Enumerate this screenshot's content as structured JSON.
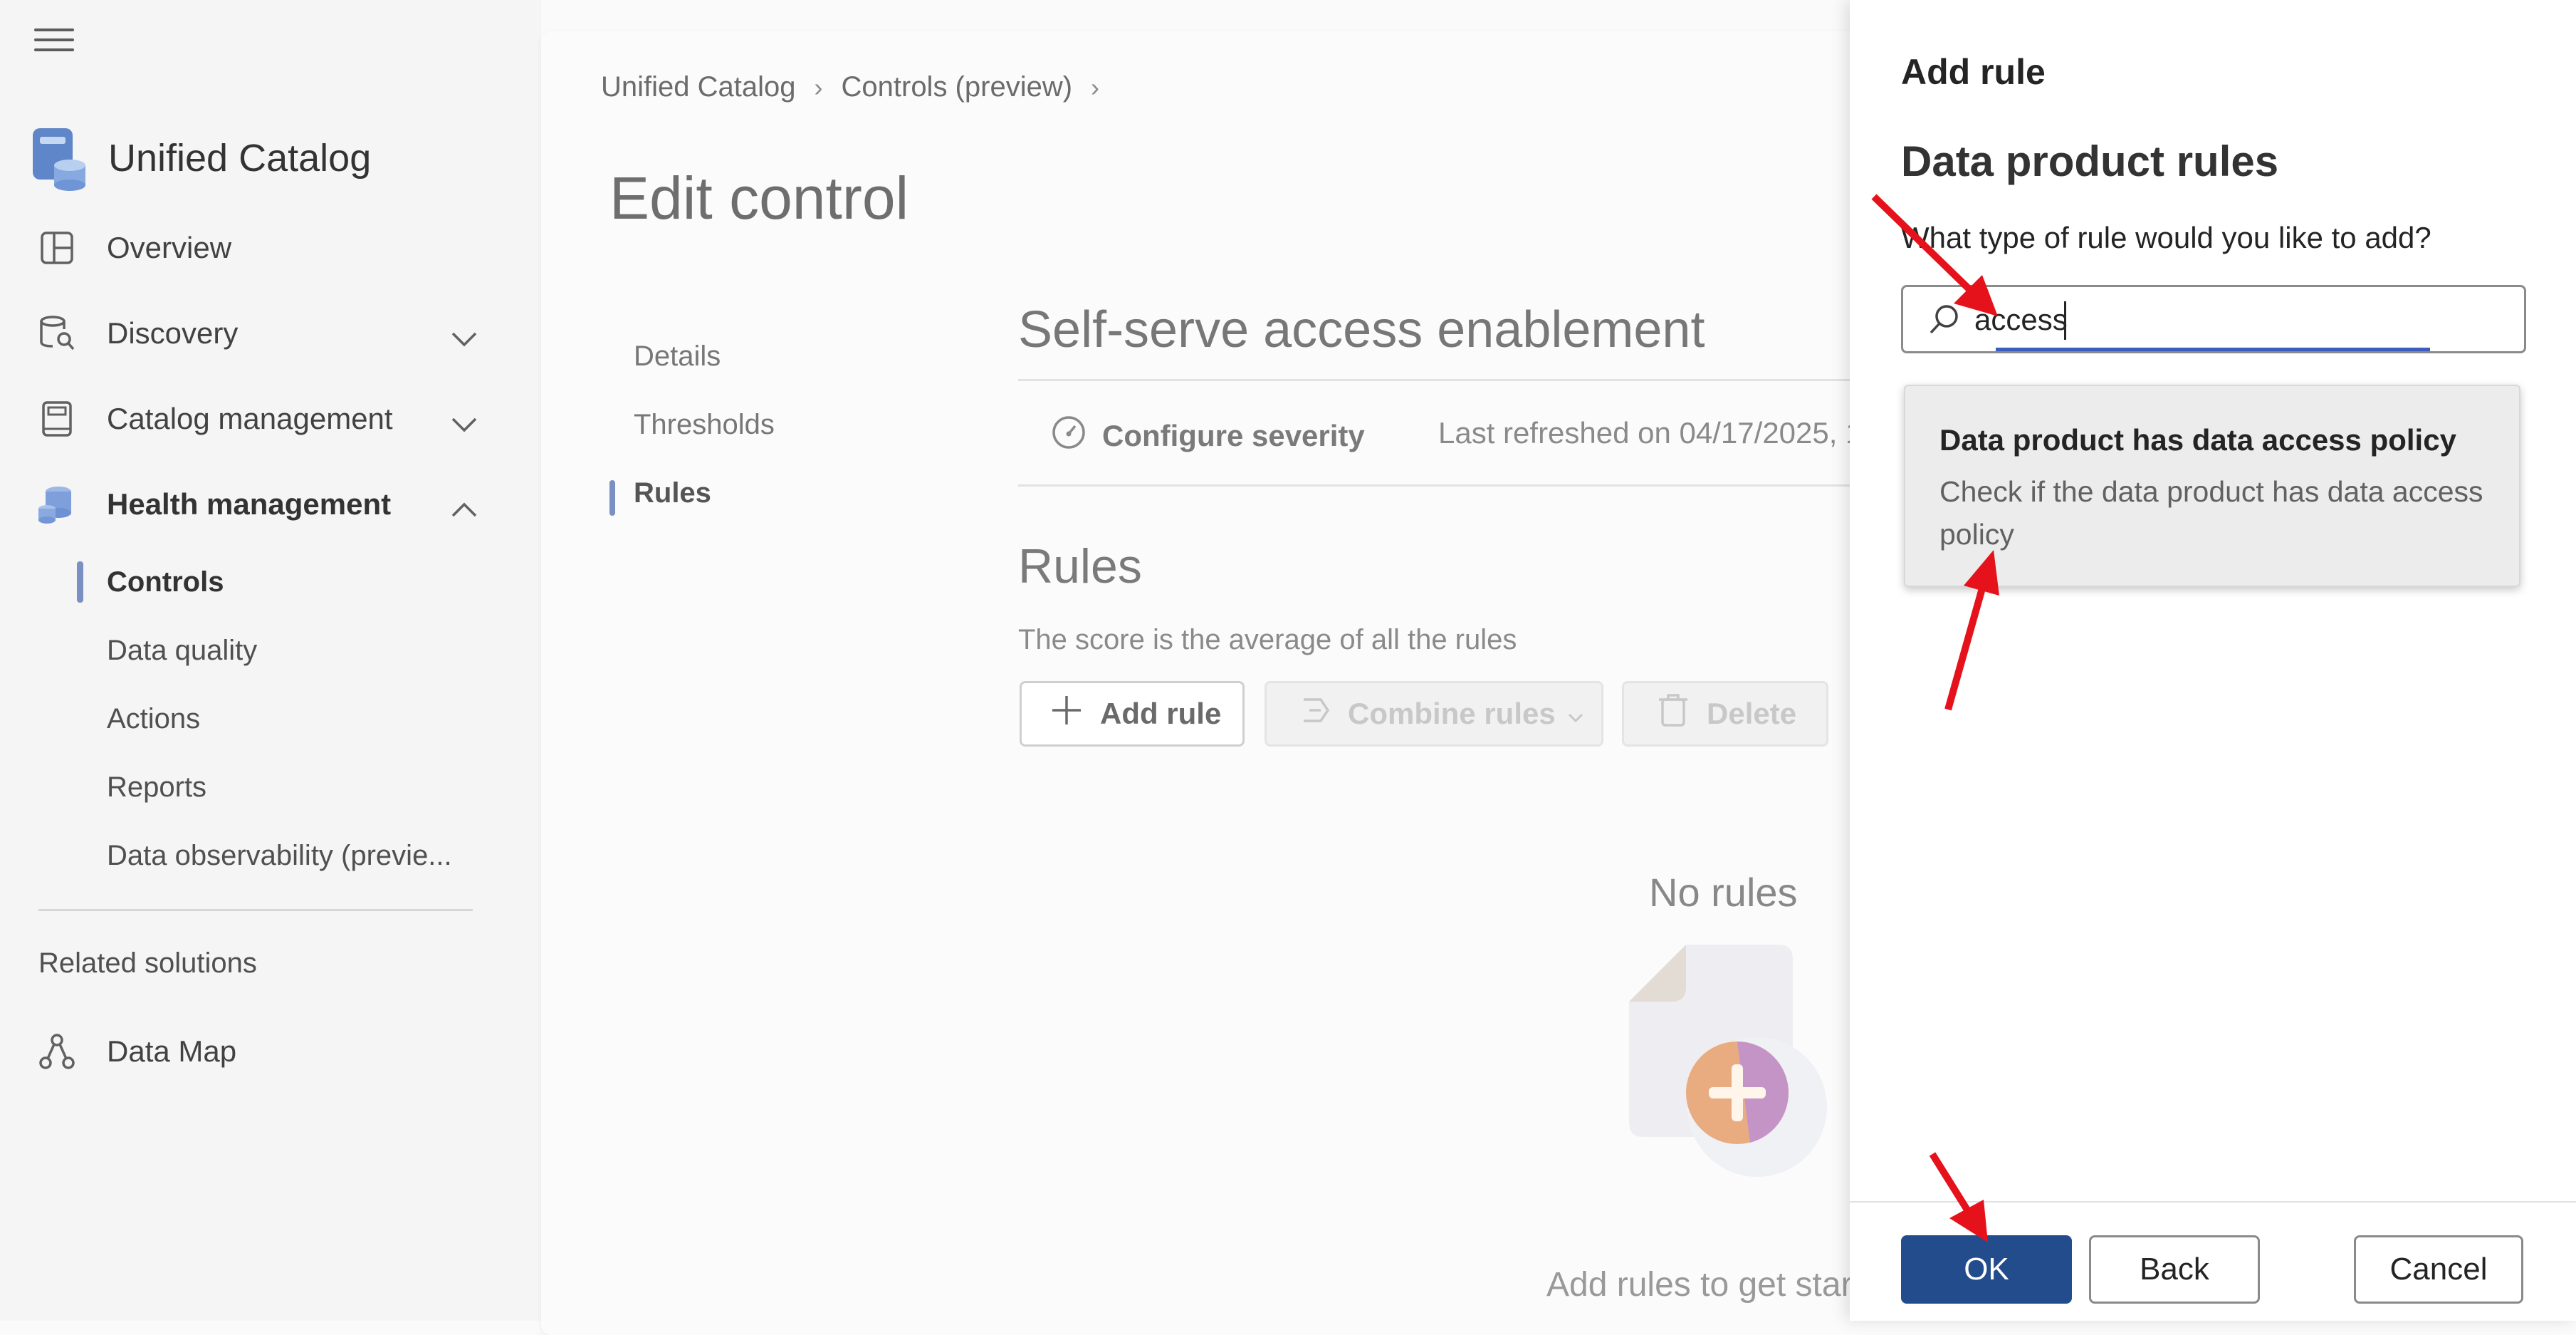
{
  "sidebar": {
    "app_title": "Unified Catalog",
    "items": [
      {
        "label": "Overview"
      },
      {
        "label": "Discovery"
      },
      {
        "label": "Catalog management"
      },
      {
        "label": "Health management"
      }
    ],
    "sub_items": [
      {
        "label": "Controls"
      },
      {
        "label": "Data quality"
      },
      {
        "label": "Actions"
      },
      {
        "label": "Reports"
      },
      {
        "label": "Data observability (previe..."
      }
    ],
    "related_label": "Related solutions",
    "related_items": [
      {
        "label": "Data Map"
      }
    ]
  },
  "main": {
    "breadcrumb": [
      "Unified Catalog",
      "Controls (preview)"
    ],
    "page_title": "Edit control",
    "tabs": [
      "Details",
      "Thresholds",
      "Rules"
    ],
    "section_title": "Self-serve access enablement",
    "configure_severity": "Configure severity",
    "last_refreshed": "Last refreshed on 04/17/2025, 1",
    "rules_title": "Rules",
    "rules_subtitle": "The score is the average of all the rules",
    "buttons": {
      "add_rule": "Add rule",
      "combine_rules": "Combine rules",
      "delete": "Delete"
    },
    "empty_title": "No rules",
    "empty_subtitle": "Add rules to get star"
  },
  "panel": {
    "title": "Add rule",
    "subtitle": "Data product rules",
    "question": "What type of rule would you like to add?",
    "search_value": "access",
    "suggestion": {
      "title": "Data product has data access policy",
      "description": "Check if the data product has data access policy"
    },
    "buttons": {
      "ok": "OK",
      "back": "Back",
      "cancel": "Cancel"
    }
  },
  "colors": {
    "accent": "#234c8c",
    "annotation_arrow": "#e5121b",
    "nav_indicator": "#7a8fc2"
  }
}
